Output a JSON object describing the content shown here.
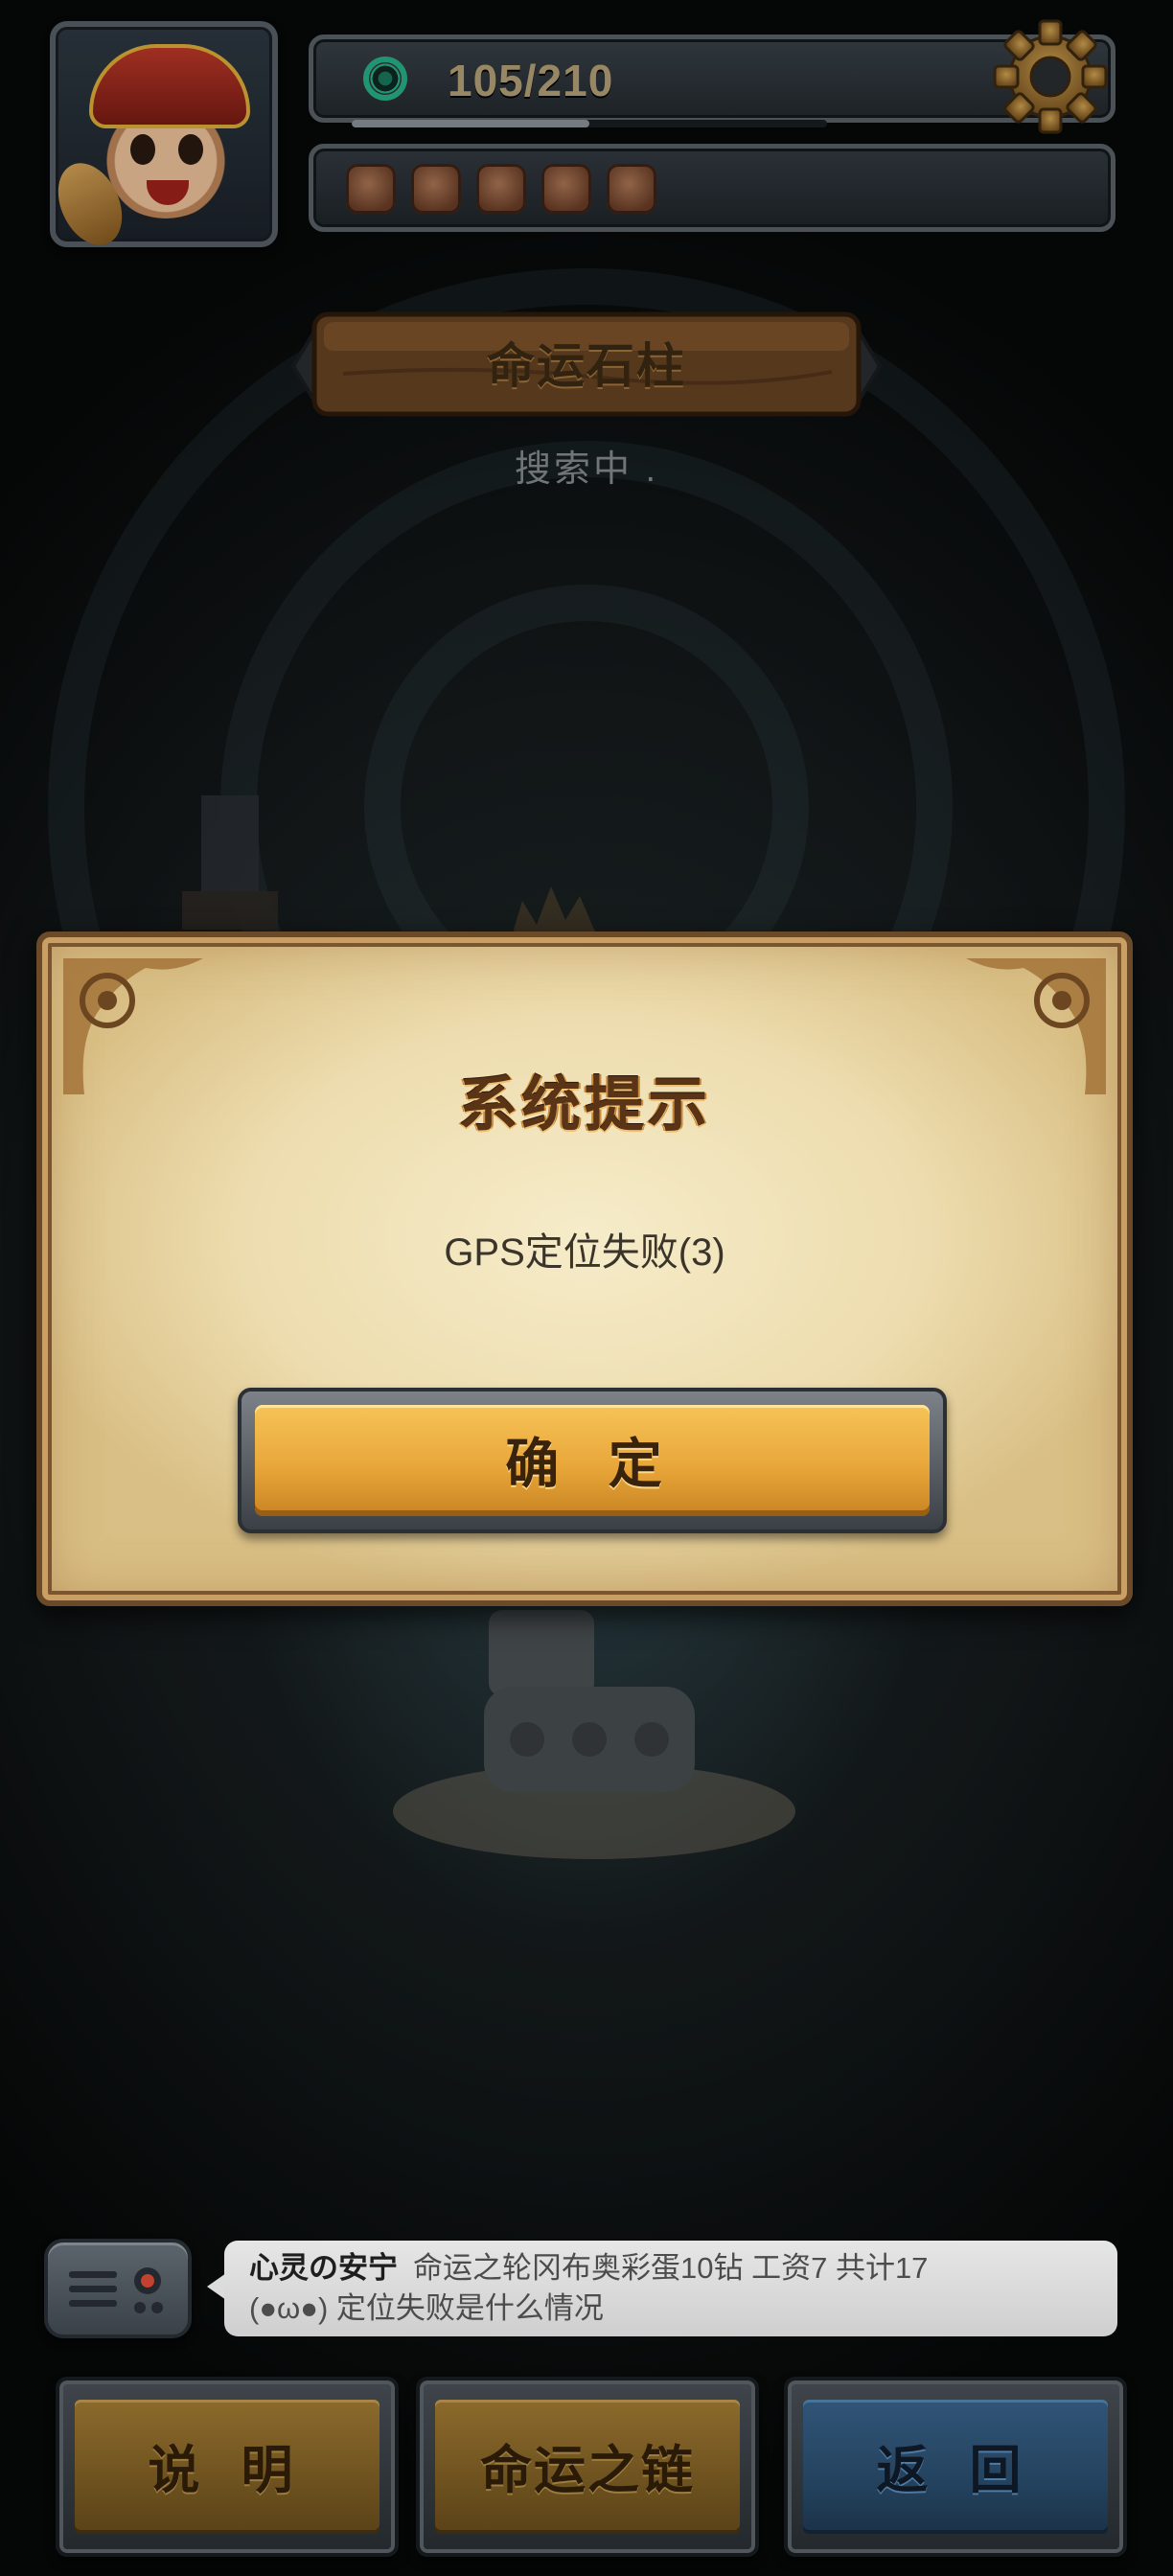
{
  "hud": {
    "energy_text": "105/210",
    "energy_fraction": 0.5,
    "gem_slots": 5
  },
  "header": {
    "title": "命运石柱",
    "status": "搜索中 ."
  },
  "dialog": {
    "title": "系统提示",
    "message": "GPS定位失败(3)",
    "confirm_label": "确 定"
  },
  "chat": {
    "sender": "心灵の安宁",
    "message_line1": "命运之轮冈布奥彩蛋10钻 工资7 共计17",
    "message_line2": "(●ω●) 定位失败是什么情况"
  },
  "bottom_nav": {
    "help_label": "说 明",
    "chain_label": "命运之链",
    "back_label": "返 回"
  },
  "colors": {
    "gold_button": "#e9a73a",
    "blue_button": "#24435f",
    "parchment": "#eddcae",
    "energy_icon": "#2bb58a"
  }
}
